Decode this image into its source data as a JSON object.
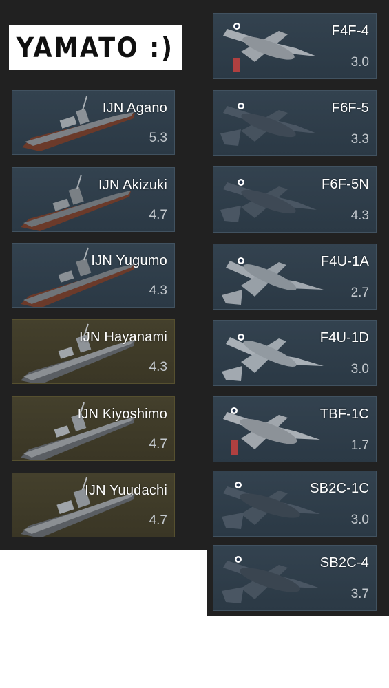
{
  "header": {
    "title": "YAMATO :)"
  },
  "ships": [
    {
      "name": "IJN Agano",
      "br": "5.3",
      "style": "blue"
    },
    {
      "name": "IJN Akizuki",
      "br": "4.7",
      "style": "blue"
    },
    {
      "name": "IJN Yugumo",
      "br": "4.3",
      "style": "blue"
    },
    {
      "name": "IJN Hayanami",
      "br": "4.3",
      "style": "gold"
    },
    {
      "name": "IJN Kiyoshimo",
      "br": "4.7",
      "style": "gold"
    },
    {
      "name": "IJN Yuudachi",
      "br": "4.7",
      "style": "gold"
    }
  ],
  "planes": [
    {
      "name": "F4F-4",
      "br": "3.0"
    },
    {
      "name": "F6F-5",
      "br": "3.3"
    },
    {
      "name": "F6F-5N",
      "br": "4.3"
    },
    {
      "name": "F4U-1A",
      "br": "2.7"
    },
    {
      "name": "F4U-1D",
      "br": "3.0"
    },
    {
      "name": "TBF-1C",
      "br": "1.7"
    },
    {
      "name": "SB2C-1C",
      "br": "3.0"
    },
    {
      "name": "SB2C-4",
      "br": "3.7"
    }
  ]
}
